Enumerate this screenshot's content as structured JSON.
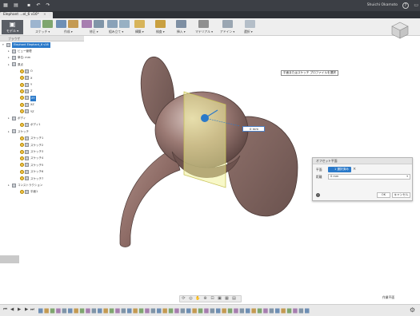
{
  "title_bar": {
    "user_name": "Shuichi Okamoto",
    "icons": [
      "grid-icon",
      "file-icon",
      "save-icon",
      "undo-icon",
      "redo-icon"
    ]
  },
  "tabs": {
    "doc_label": "Elephant ...el_6 v16*",
    "close": "×",
    "add": "+"
  },
  "ribbon": {
    "workspace_label": "モデル ▾",
    "groups": [
      "スケッチ",
      "作成",
      "修正",
      "組み立て",
      "構築",
      "検査",
      "挿入",
      "マテリアル",
      "アドイン",
      "選択"
    ]
  },
  "browser": {
    "header": "ブラウザ",
    "root_label": "Elephant Elephant_6 v16",
    "rows": [
      {
        "label": "ビュー管理",
        "level": 1
      },
      {
        "label": "単位: mm",
        "level": 1
      },
      {
        "label": "原点",
        "level": 1
      },
      {
        "label": "O",
        "level": 2
      },
      {
        "label": "X",
        "level": 2
      },
      {
        "label": "Y",
        "level": 2
      },
      {
        "label": "Z",
        "level": 2
      },
      {
        "label": "XY",
        "level": 2
      },
      {
        "label": "XZ",
        "level": 2
      },
      {
        "label": "YZ",
        "level": 2
      },
      {
        "label": "ボディ",
        "level": 1
      },
      {
        "label": "ボディ1",
        "level": 2
      },
      {
        "label": "スケッチ",
        "level": 1
      },
      {
        "label": "スケッチ1",
        "level": 2
      },
      {
        "label": "スケッチ2",
        "level": 2
      },
      {
        "label": "スケッチ3",
        "level": 2
      },
      {
        "label": "スケッチ4",
        "level": 2
      },
      {
        "label": "スケッチ5",
        "level": 2
      },
      {
        "label": "スケッチ6",
        "level": 2
      },
      {
        "label": "スケッチ7",
        "level": 2
      },
      {
        "label": "コンストラクション",
        "level": 1
      },
      {
        "label": "平面1",
        "level": 2
      }
    ]
  },
  "viewport": {
    "tooltip": "平面またはスケッチ プロファイルを選択",
    "dim_value": "0 mm"
  },
  "dialog": {
    "title": "オフセット平面",
    "plane_label": "平面",
    "plane_value": "1 選択済み",
    "plane_clear": "×",
    "distance_label": "距離",
    "distance_value": "0 mm",
    "ok": "OK",
    "cancel": "キャンセル"
  },
  "status": {
    "comments": "作業平面"
  },
  "colors": {
    "title_bar": "#3c3f45",
    "selection_blue": "#2a79c9",
    "model_body": "#8c6a63",
    "plane_yellow": "#f2f29a"
  }
}
